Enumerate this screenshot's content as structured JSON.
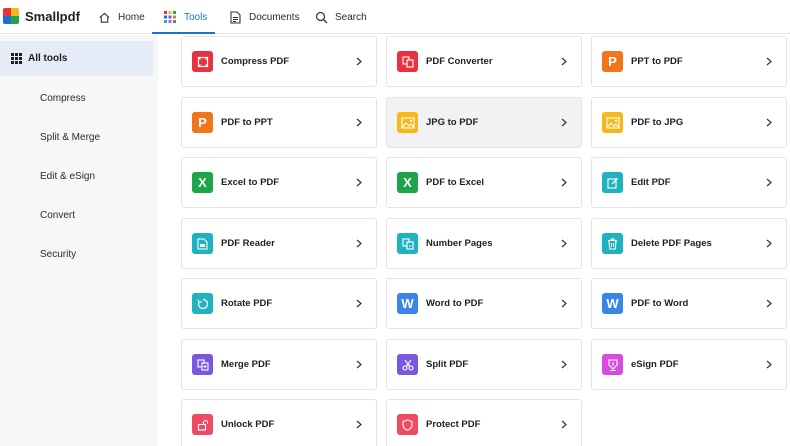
{
  "app": {
    "name": "Smallpdf"
  },
  "nav": {
    "home": "Home",
    "tools": "Tools",
    "documents": "Documents",
    "search": "Search"
  },
  "sidebar": {
    "all_tools": "All tools",
    "items": [
      "Compress",
      "Split & Merge",
      "Edit & eSign",
      "Convert",
      "Security"
    ]
  },
  "tools": [
    {
      "label": "Compress PDF",
      "icon": "compress-icon",
      "color": "#e5343f"
    },
    {
      "label": "PDF Converter",
      "icon": "converter-icon",
      "color": "#e5343f"
    },
    {
      "label": "PPT to PDF",
      "icon": "ppt-icon",
      "color": "#f2741c"
    },
    {
      "label": "PDF to PPT",
      "icon": "ppt-icon",
      "color": "#f2741c"
    },
    {
      "label": "JPG to PDF",
      "icon": "image-icon",
      "color": "#f6b91a"
    },
    {
      "label": "PDF to JPG",
      "icon": "image-icon",
      "color": "#f6b91a"
    },
    {
      "label": "Excel to PDF",
      "icon": "excel-icon",
      "color": "#1ea44c"
    },
    {
      "label": "PDF to Excel",
      "icon": "excel-icon",
      "color": "#1ea44c"
    },
    {
      "label": "Edit PDF",
      "icon": "edit-icon",
      "color": "#1fb3bf"
    },
    {
      "label": "PDF Reader",
      "icon": "reader-icon",
      "color": "#1fb3bf"
    },
    {
      "label": "Number Pages",
      "icon": "number-pages-icon",
      "color": "#1fb3bf"
    },
    {
      "label": "Delete PDF Pages",
      "icon": "trash-icon",
      "color": "#1fb3bf"
    },
    {
      "label": "Rotate PDF",
      "icon": "rotate-icon",
      "color": "#1fb3bf"
    },
    {
      "label": "Word to PDF",
      "icon": "word-icon",
      "color": "#3a86e8"
    },
    {
      "label": "PDF to Word",
      "icon": "word-icon",
      "color": "#3a86e8"
    },
    {
      "label": "Merge PDF",
      "icon": "merge-icon",
      "color": "#7b57e0"
    },
    {
      "label": "Split PDF",
      "icon": "split-icon",
      "color": "#7b57e0"
    },
    {
      "label": "eSign PDF",
      "icon": "esign-icon",
      "color": "#d84be0"
    },
    {
      "label": "Unlock PDF",
      "icon": "unlock-icon",
      "color": "#ee4a62"
    },
    {
      "label": "Protect PDF",
      "icon": "shield-icon",
      "color": "#ee4a62"
    }
  ],
  "colors": {
    "accent": "#1f6fd1",
    "sidebar_active": "#e6ecf7"
  }
}
